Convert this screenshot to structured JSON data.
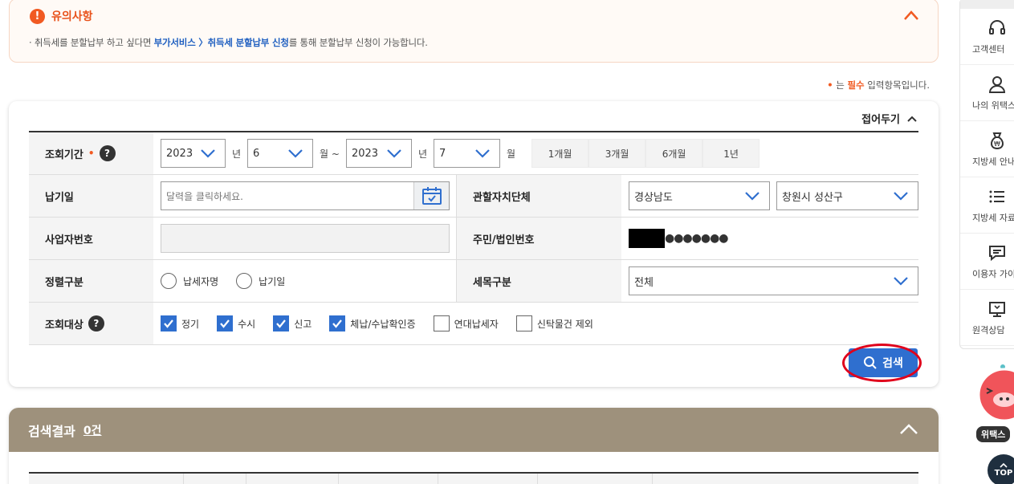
{
  "notice": {
    "title": "유의사항",
    "text_prefix": "· 취득세를 분할납부 하고 싶다면 ",
    "text_link": "부가서비스 〉취득세 분할납부 신청",
    "text_suffix": "를 통해 분할납부 신청이 가능합니다."
  },
  "required_note": {
    "dot": "•",
    "prefix": " 는 ",
    "highlight": "필수",
    "suffix": " 입력항목입니다."
  },
  "panel": {
    "collapse_label": "접어두기",
    "search_label": "검색"
  },
  "form": {
    "period": {
      "label": "조회기간",
      "required": "•",
      "help": "?",
      "from_year": "2023",
      "year_unit": "년",
      "from_month": "6",
      "month_unit_tilde": "월 ~",
      "to_year": "2023",
      "to_month": "7",
      "month_unit": "월",
      "buttons": [
        "1개월",
        "3개월",
        "6개월",
        "1년"
      ]
    },
    "pay_date": {
      "label": "납기일",
      "placeholder": "달력을 클릭하세요."
    },
    "local_gov": {
      "label": "관할자치단체",
      "province": "경상남도",
      "city": "창원시 성산구"
    },
    "business_no": {
      "label": "사업자번호"
    },
    "resident_no": {
      "label": "주민/법인번호",
      "masked": "●●●●●●●"
    },
    "sort": {
      "label": "정렬구분",
      "options": [
        "납세자명",
        "납기일"
      ]
    },
    "tax_item": {
      "label": "세목구분",
      "value": "전체"
    },
    "target": {
      "label": "조회대상",
      "help": "?",
      "options": [
        {
          "label": "정기",
          "checked": true
        },
        {
          "label": "수시",
          "checked": true
        },
        {
          "label": "신고",
          "checked": true
        },
        {
          "label": "체납/수납확인증",
          "checked": true
        },
        {
          "label": "연대납세자",
          "checked": false
        },
        {
          "label": "신탁물건 제외",
          "checked": false
        }
      ]
    }
  },
  "results": {
    "title": "검색결과",
    "count": "0건"
  },
  "sidebar": {
    "items": [
      {
        "label": "고객센터",
        "icon": "headset-icon"
      },
      {
        "label": "나의 위택스",
        "icon": "user-icon"
      },
      {
        "label": "지방세 안내",
        "icon": "money-bag-icon"
      },
      {
        "label": "지방세 자료실",
        "icon": "list-icon"
      },
      {
        "label": "이용자 가이드",
        "icon": "chat-icon"
      },
      {
        "label": "원격상담",
        "icon": "monitor-icon"
      }
    ],
    "mascot_label": "위택스",
    "top_label": "TOP"
  },
  "colors": {
    "accent": "#2f6fcf",
    "notice": "#f15a22",
    "results_header": "#9e917c",
    "highlight_ring": "#e0001b"
  }
}
